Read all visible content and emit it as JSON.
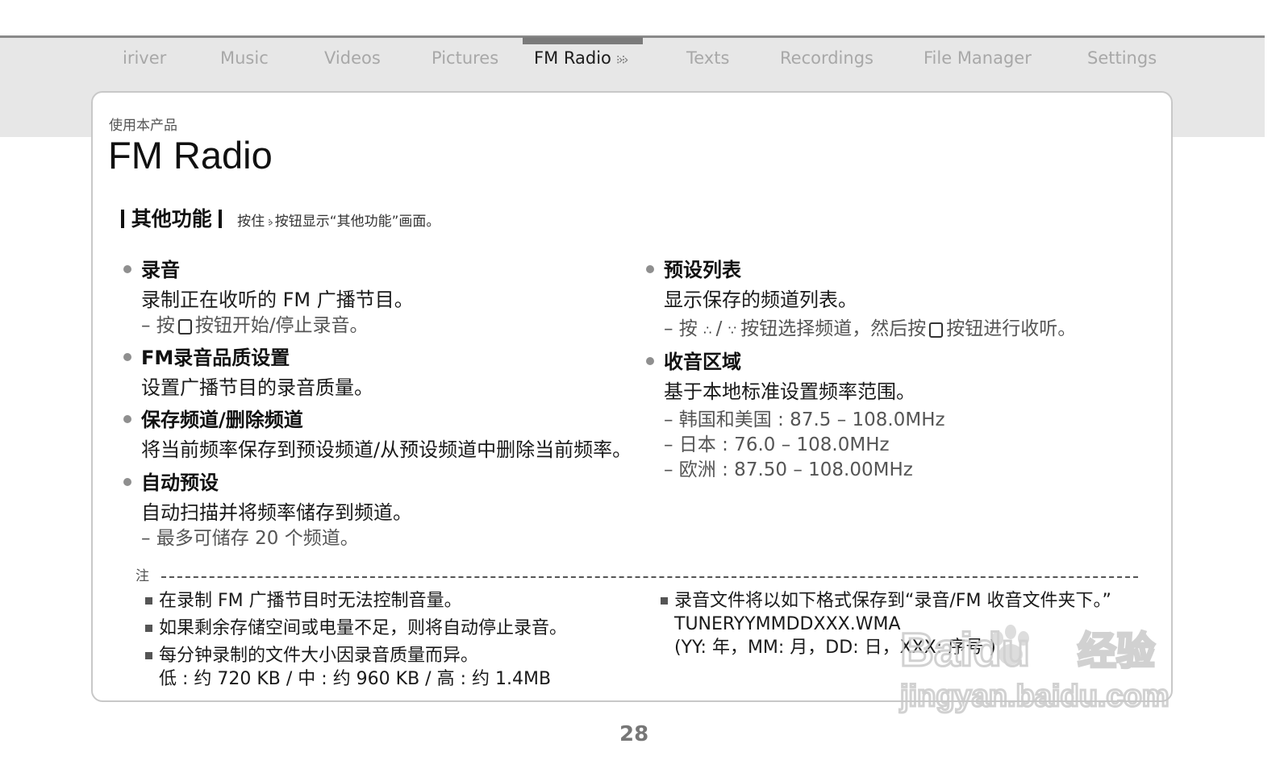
{
  "nav": {
    "tabs": [
      "iriver",
      "Music",
      "Videos",
      "Pictures",
      "FM Radio",
      "Texts",
      "Recordings",
      "File Manager",
      "Settings"
    ],
    "active_index": 4
  },
  "page": {
    "breadcrumb": "使用本产品",
    "title": "FM Radio"
  },
  "section": {
    "heading": "其他功能",
    "desc_prefix": "按住",
    "desc_suffix": "按钮显示“其他功能”画面。"
  },
  "left_items": [
    {
      "heading": "录音",
      "desc": "录制正在收听的 FM 广播节目。",
      "sub_prefix": "– 按",
      "sub_suffix": "按钮开始/停止录音。"
    },
    {
      "heading": "FM录音品质设置",
      "desc": "设置广播节目的录音质量。"
    },
    {
      "heading": "保存频道/删除频道",
      "desc": "将当前频率保存到预设频道/从预设频道中删除当前频率。"
    },
    {
      "heading": "自动预设",
      "desc": "自动扫描并将频率储存到频道。",
      "sub": "– 最多可储存 20 个频道。"
    }
  ],
  "right_items": [
    {
      "heading": "预设列表",
      "desc": "显示保存的频道列表。",
      "sub_prefix": "– 按",
      "sub_mid": "按钮选择频道，然后按",
      "sub_suffix": "按钮进行收听。"
    },
    {
      "heading": "收音区域",
      "desc": "基于本地标准设置频率范围。",
      "subs": [
        "– 韩国和美国 : 87.5 – 108.0MHz",
        "– 日本 :  76.0 – 108.0MHz",
        "– 欧洲 : 87.50 – 108.00MHz"
      ]
    }
  ],
  "notes": {
    "label": "注",
    "left": [
      "在录制 FM 广播节目时无法控制音量。",
      "如果剩余存储空间或电量不足，则将自动停止录音。",
      "每分钟录制的文件大小因录音质量而异。"
    ],
    "left_extra": "低 : 约 720 KB / 中 : 约 960 KB / 高 : 约 1.4MB",
    "right": "录音文件将以如下格式保存到“录音/FM 收音文件夹下。”",
    "right_line2": "TUNERYYMMDDXXX.WMA",
    "right_line3": "(YY: 年，MM: 月，DD: 日，XXX: 序号 )"
  },
  "watermark": {
    "brand": "Baidu",
    "brand_cn": "经验",
    "url": "jingyan.baidu.com"
  },
  "page_number": "28"
}
